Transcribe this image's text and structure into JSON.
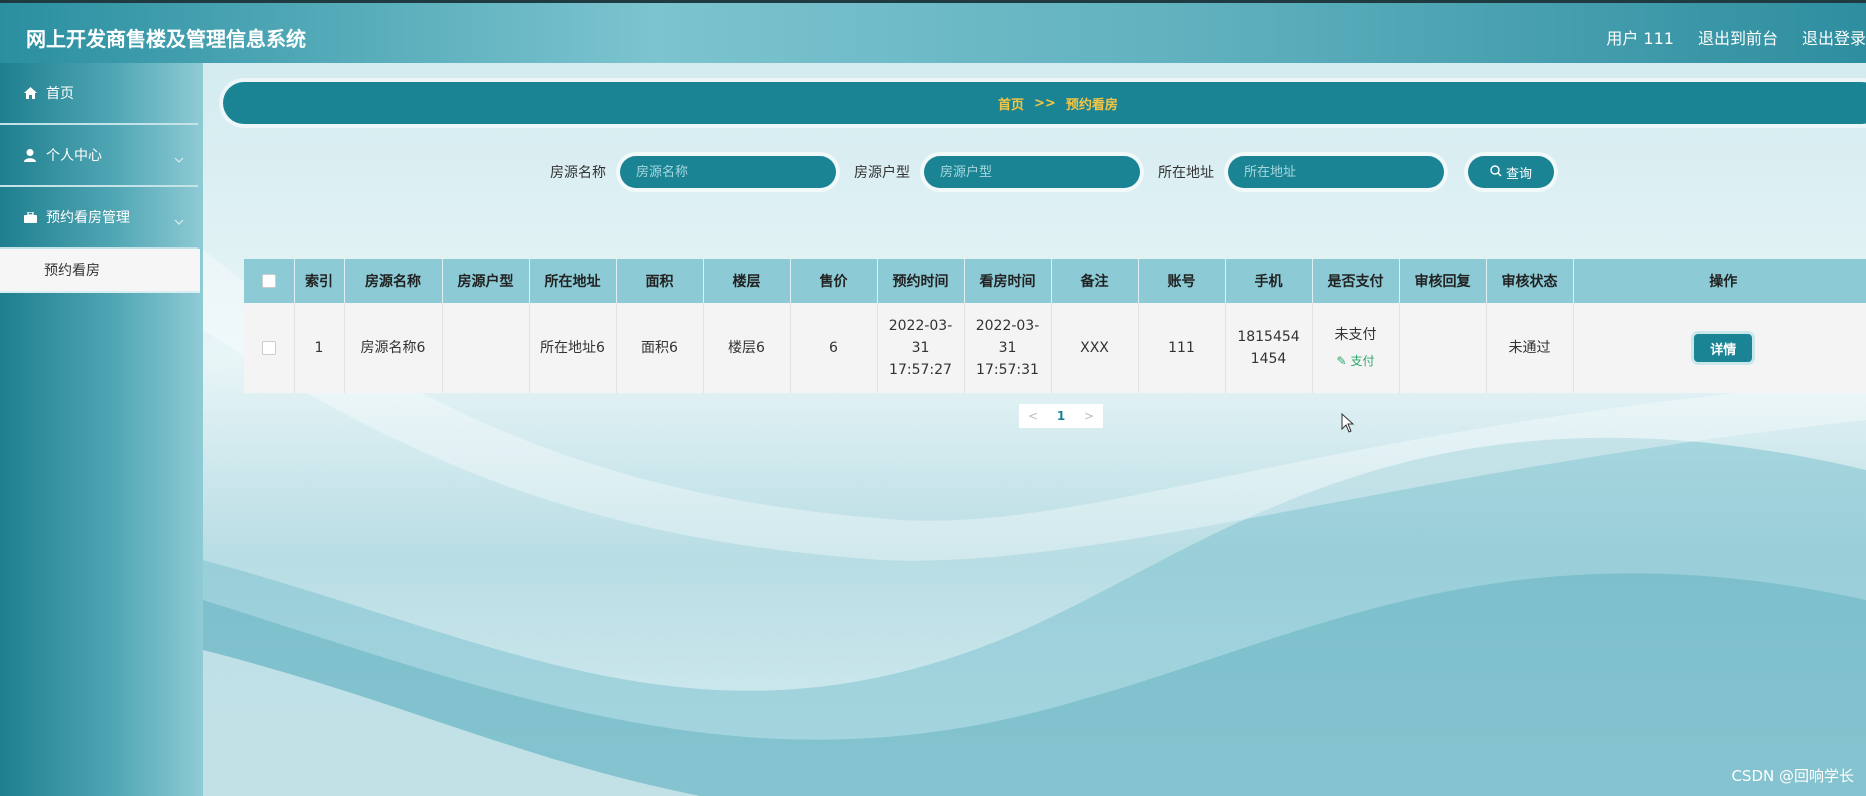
{
  "header": {
    "title": "网上开发商售楼及管理信息系统",
    "user": "用户 111",
    "back_front": "退出到前台",
    "logout": "退出登录"
  },
  "sidebar": {
    "items": [
      {
        "label": "首页",
        "icon": "home-icon"
      },
      {
        "label": "个人中心",
        "icon": "user-icon"
      },
      {
        "label": "预约看房管理",
        "icon": "briefcase-icon"
      }
    ],
    "subitem": "预约看房"
  },
  "breadcrumb": {
    "home": "首页",
    "sep": ">>",
    "current": "预约看房"
  },
  "search": {
    "name_label": "房源名称",
    "name_placeholder": "房源名称",
    "type_label": "房源户型",
    "type_placeholder": "房源户型",
    "addr_label": "所在地址",
    "addr_placeholder": "所在地址",
    "button": "查询"
  },
  "table": {
    "headers": [
      "索引",
      "房源名称",
      "房源户型",
      "所在地址",
      "面积",
      "楼层",
      "售价",
      "预约时间",
      "看房时间",
      "备注",
      "账号",
      "手机",
      "是否支付",
      "审核回复",
      "审核状态",
      "操作"
    ],
    "rows": [
      {
        "index": "1",
        "name": "房源名称6",
        "type": "",
        "addr": "所在地址6",
        "area": "面积6",
        "floor": "楼层6",
        "price": "6",
        "appoint_time": "2022-03-31 17:57:27",
        "view_time": "2022-03-31 17:57:31",
        "note": "XXX",
        "account": "111",
        "phone": "18154541454",
        "paid": "未支付",
        "pay_link": "支付",
        "reply": "",
        "status": "未通过",
        "action": "详情"
      }
    ]
  },
  "pagination": {
    "prev": "<",
    "page": "1",
    "next": ">"
  },
  "watermark": "CSDN @回响学长",
  "colors": {
    "accent": "#1b8494",
    "breadcrumb_text": "#f5c542",
    "pay_link": "#2aa86a"
  }
}
